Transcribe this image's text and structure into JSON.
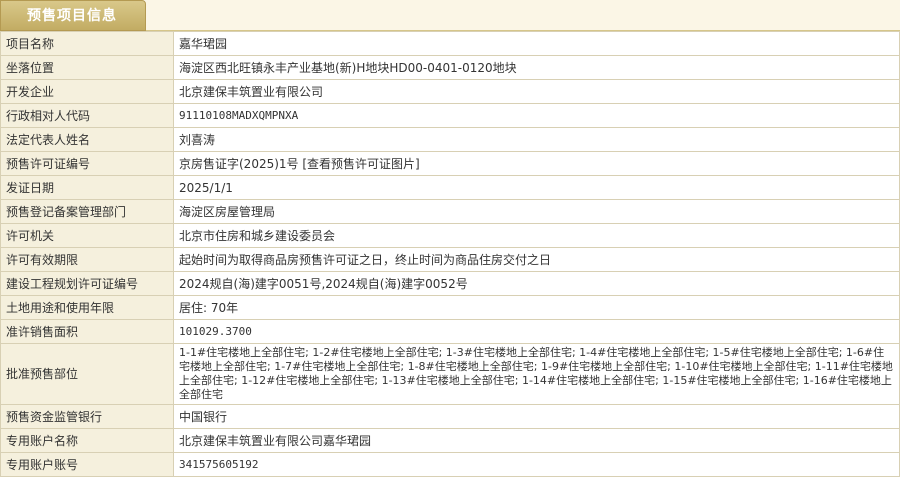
{
  "tab": {
    "title": "预售项目信息"
  },
  "colors": {
    "tab_bg": "#c9b470",
    "label_bg": "#f5f0dd",
    "border": "#d8d0b4"
  },
  "rows": {
    "project_name": {
      "label": "项目名称",
      "value": "嘉华珺园"
    },
    "location": {
      "label": "坐落位置",
      "value": "海淀区西北旺镇永丰产业基地(新)H地块HD00-0401-0120地块"
    },
    "developer": {
      "label": "开发企业",
      "value": "北京建保丰筑置业有限公司"
    },
    "admin_code": {
      "label": "行政相对人代码",
      "value": "91110108MADXQMPNXA"
    },
    "legal_rep": {
      "label": "法定代表人姓名",
      "value": "刘喜涛"
    },
    "license_no": {
      "label": "预售许可证编号",
      "value": "京房售证字(2025)1号",
      "link": "[查看预售许可证图片]"
    },
    "issue_date": {
      "label": "发证日期",
      "value": "2025/1/1"
    },
    "registry_dept": {
      "label": "预售登记备案管理部门",
      "value": "海淀区房屋管理局"
    },
    "issuing_authority": {
      "label": "许可机关",
      "value": "北京市住房和城乡建设委员会"
    },
    "validity": {
      "label": "许可有效期限",
      "value": "起始时间为取得商品房预售许可证之日，终止时间为商品住房交付之日"
    },
    "planning_permit": {
      "label": "建设工程规划许可证编号",
      "value": "2024规自(海)建字0051号,2024规自(海)建字0052号"
    },
    "land_use": {
      "label": "土地用途和使用年限",
      "value": "居住: 70年"
    },
    "sale_area": {
      "label": "准许销售面积",
      "value": "101029.3700"
    },
    "presale_parts": {
      "label": "批准预售部位",
      "value": "1-1#住宅楼地上全部住宅; 1-2#住宅楼地上全部住宅; 1-3#住宅楼地上全部住宅; 1-4#住宅楼地上全部住宅; 1-5#住宅楼地上全部住宅; 1-6#住宅楼地上全部住宅; 1-7#住宅楼地上全部住宅; 1-8#住宅楼地上全部住宅; 1-9#住宅楼地上全部住宅; 1-10#住宅楼地上全部住宅; 1-11#住宅楼地上全部住宅; 1-12#住宅楼地上全部住宅; 1-13#住宅楼地上全部住宅; 1-14#住宅楼地上全部住宅; 1-15#住宅楼地上全部住宅; 1-16#住宅楼地上全部住宅"
    },
    "supervising_bank": {
      "label": "预售资金监管银行",
      "value": "中国银行"
    },
    "account_name": {
      "label": "专用账户名称",
      "value": "北京建保丰筑置业有限公司嘉华珺园"
    },
    "account_no": {
      "label": "专用账户账号",
      "value": "341575605192"
    }
  }
}
